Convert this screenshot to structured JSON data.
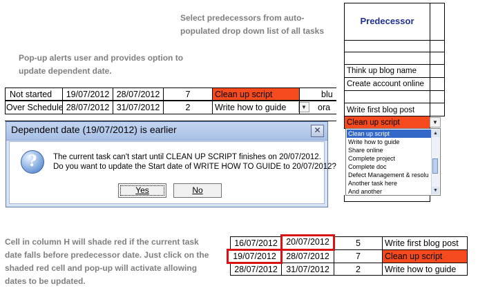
{
  "notes": {
    "select_line1": "Select predecessors from auto-",
    "select_line2": "populated drop down list of all tasks",
    "popup_line1": "Pop-up alerts user and provides option to",
    "popup_line2": "update dependent date.",
    "bottom_line1": "Cell in column H will shade red if the current task",
    "bottom_line2": "date falls before predecessor date. Just click on the",
    "bottom_line3": "shaded red cell and pop-up will activate allowing",
    "bottom_line4": "dates to be updated."
  },
  "top_rows": [
    {
      "status": "Not started",
      "start": "19/07/2012",
      "end": "28/07/2012",
      "num": "7",
      "pred": "Clean up script",
      "extra": "blu"
    },
    {
      "status": "Over Schedule",
      "start": "28/07/2012",
      "end": "31/07/2012",
      "num": "2",
      "pred": "Write how to guide",
      "extra": "ora"
    }
  ],
  "predecessor_column": {
    "header": "Predecessor",
    "items": [
      "Think up blog name",
      "Create account online",
      "Write first blog post",
      "Clean up script"
    ]
  },
  "dropdown": {
    "options": [
      "Clean up script",
      "Write how to guide",
      "Share online",
      "Complete project",
      "Complete doc",
      "Defect Management & resolu",
      "Another task here",
      "And another"
    ]
  },
  "dialog": {
    "title": "Dependent date (19/07/2012) is earlier",
    "message_line1": "The current task can't start until  CLEAN UP SCRIPT  finishes on 20/07/2012.",
    "message_line2": "Do you want to update the Start date of  WRITE HOW TO GUIDE  to 20/07/2012?",
    "yes_label": "Yes",
    "no_label": "No",
    "close_glyph": "✕",
    "icon_glyph": "?"
  },
  "bottom_rows": [
    {
      "start": "16/07/2012",
      "end": "20/07/2012",
      "num": "5",
      "pred": "Write first blog post"
    },
    {
      "start": "19/07/2012",
      "end": "28/07/2012",
      "num": "7",
      "pred": "Clean up script"
    },
    {
      "start": "28/07/2012",
      "end": "31/07/2012",
      "num": "2",
      "pred": "Write how to guide"
    }
  ],
  "colors": {
    "red_cell": "#f54a1d",
    "highlight_border": "#d81212",
    "header_text": "#1f2f8f",
    "note_text": "#7f7f7f"
  }
}
